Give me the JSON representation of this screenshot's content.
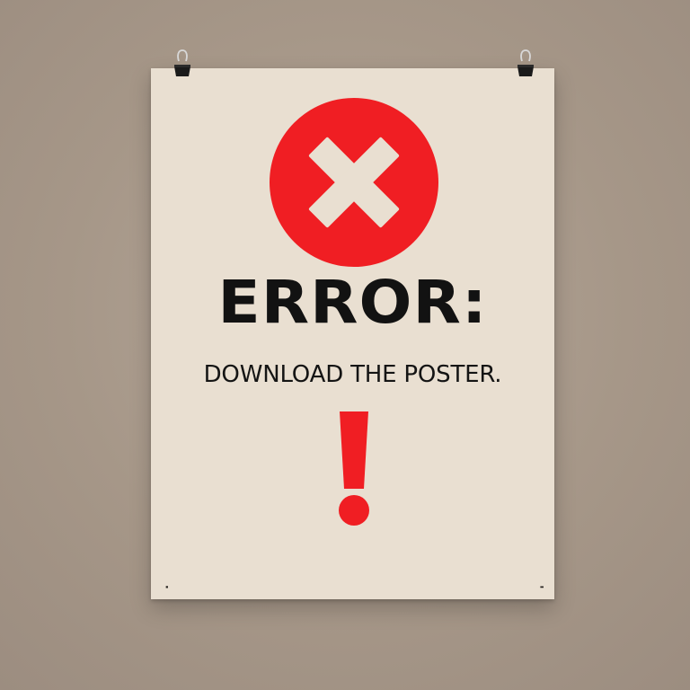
{
  "poster": {
    "title": "ERROR:",
    "subtitle": "DOWNLOAD THE POSTER.",
    "fineprint_line_1": "",
    "fineprint_line_2": "",
    "x_icon": "close-circle-icon",
    "exclamation_icon": "exclamation-icon"
  },
  "colors": {
    "wall": "#a89a8e",
    "paper": "#e9dfd1",
    "accent_red": "#f01e23",
    "text_dark": "#121212"
  }
}
